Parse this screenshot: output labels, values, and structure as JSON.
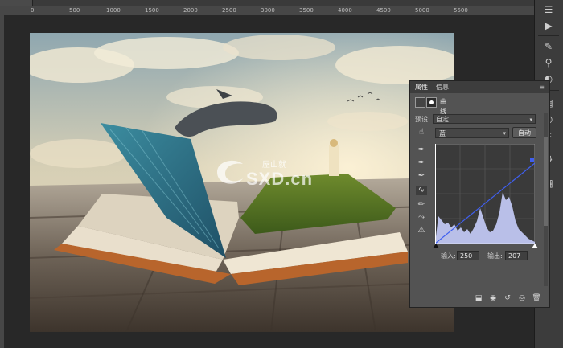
{
  "ruler": {
    "labels": [
      "0",
      "500",
      "1000",
      "1500",
      "2000",
      "2500",
      "3000",
      "3500",
      "4000",
      "4500",
      "5000",
      "5500"
    ]
  },
  "panel": {
    "tabs": [
      "属性",
      "信息"
    ],
    "menu_icon": "panel-menu-icon",
    "title": "曲线",
    "preset_label": "预设:",
    "preset_value": "自定",
    "channel_value": "蓝",
    "auto_label": "自动",
    "input_label": "输入:",
    "input_value": "250",
    "output_label": "输出:",
    "output_value": "207"
  },
  "watermark": {
    "text_small": "屋山就",
    "text_domain": "SXD.cn"
  },
  "colors": {
    "curve_line": "#3f5ff0",
    "histogram": "#b9bfe8",
    "panel_bg": "#535353"
  }
}
